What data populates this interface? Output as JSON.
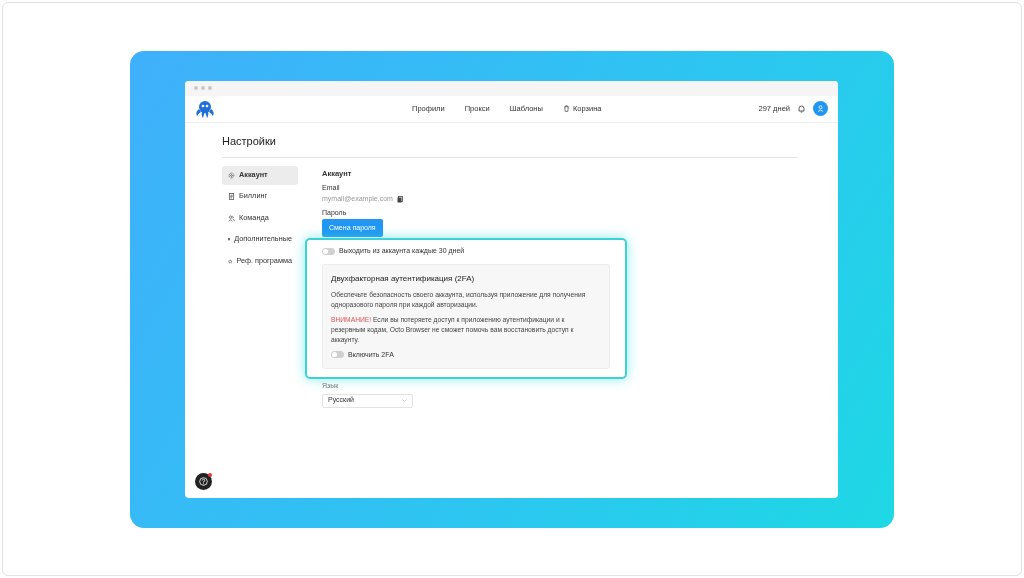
{
  "nav": {
    "items": [
      {
        "label": "Профили",
        "kind": "text"
      },
      {
        "label": "Прокси",
        "kind": "text"
      },
      {
        "label": "Шаблоны",
        "kind": "text"
      },
      {
        "label": "Корзина",
        "kind": "trash"
      }
    ],
    "days": "297 дней"
  },
  "page_title": "Настройки",
  "sidebar": {
    "items": [
      {
        "label": "Аккаунт",
        "selected": true
      },
      {
        "label": "Биллинг",
        "selected": false
      },
      {
        "label": "Команда",
        "selected": false
      },
      {
        "label": "Дополнительные",
        "selected": false
      },
      {
        "label": "Реф. программа",
        "selected": false
      }
    ]
  },
  "account": {
    "heading": "Аккаунт",
    "email_label": "Email",
    "email": "mymail@example.com",
    "password_label": "Пароль",
    "password_button": "Смена пароля"
  },
  "logout_toggle": {
    "label": "Выходить из аккаунта каждые 30 дней",
    "on": false
  },
  "two_fa": {
    "title": "Двухфакторная аутентификация (2FA)",
    "description": "Обеспечьте безопасность своего аккаунта, используя приложение для получения одноразового пароля при каждой авторизации.",
    "warning_label": "ВНИМАНИЕ!",
    "warning_text": "Если вы потеряете доступ к приложению аутентификации и к резервным кодам, Octo Browser не сможет помочь вам восстановить доступ к аккаунту.",
    "toggle": {
      "label": "Включить 2FA",
      "on": false
    }
  },
  "language": {
    "label": "Язык",
    "value": "Русский"
  }
}
